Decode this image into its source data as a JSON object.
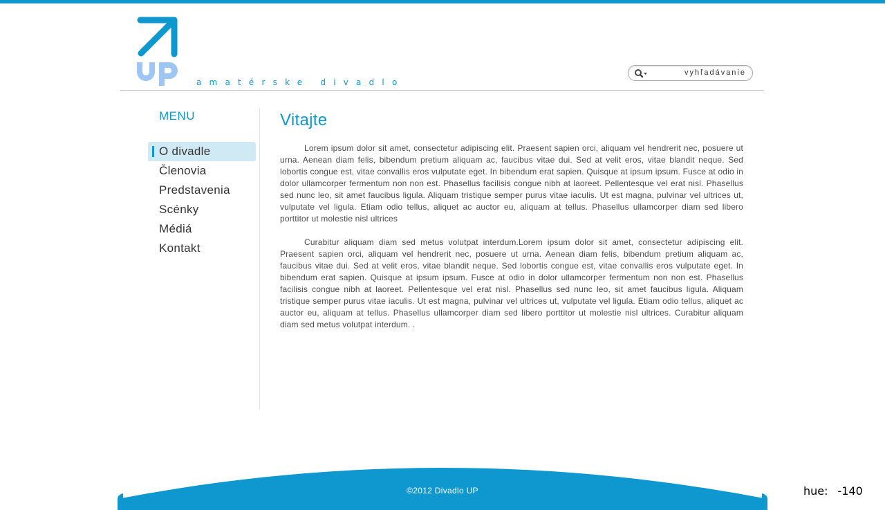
{
  "header": {
    "logo_letters": "UP",
    "tagline": "amatérske divadlo",
    "search": {
      "placeholder": "vyhľadávanie"
    }
  },
  "sidebar": {
    "title": "MENU",
    "items": [
      {
        "label": "O divadle",
        "active": true
      },
      {
        "label": "Členovia",
        "active": false
      },
      {
        "label": "Predstavenia",
        "active": false
      },
      {
        "label": "Scénky",
        "active": false
      },
      {
        "label": "Médiá",
        "active": false
      },
      {
        "label": "Kontakt",
        "active": false
      }
    ]
  },
  "content": {
    "title": "Vitajte",
    "paragraphs": [
      "Lorem ipsum dolor sit amet, consectetur adipiscing elit. Praesent sapien orci, aliquam vel hendrerit nec, posuere ut urna. Aenean diam felis, bibendum pretium aliquam ac, faucibus vitae dui. Sed at velit eros, vitae blandit neque. Sed lobortis congue est, vitae convallis eros vulputate eget. In bibendum erat sapien. Quisque at ipsum ipsum. Fusce at odio in dolor ullamcorper fermentum non non est. Phasellus facilisis congue nibh at laoreet. Pellentesque vel erat nisl. Phasellus sed nunc leo, sit amet faucibus ligula. Aliquam tristique semper purus vitae iaculis. Ut est magna, pulvinar vel ultrices ut, vulputate vel ligula. Etiam odio tellus, aliquet ac auctor eu, aliquam at tellus. Phasellus ullamcorper diam sed libero porttitor ut molestie nisl ultrices",
      "Curabitur aliquam diam sed metus volutpat interdum.Lorem ipsum dolor sit amet, consectetur adipiscing elit. Praesent sapien orci, aliquam vel hendrerit nec, posuere ut urna. Aenean diam felis, bibendum pretium aliquam ac, faucibus vitae dui. Sed at velit eros, vitae blandit neque. Sed lobortis congue est, vitae convallis eros vulputate eget. In bibendum erat sapien. Quisque at ipsum ipsum. Fusce at odio in dolor ullamcorper fermentum non non est. Phasellus facilisis congue nibh at laoreet. Pellentesque vel erat nisl. Phasellus sed nunc leo, sit amet faucibus ligula. Aliquam tristique semper purus vitae iaculis. Ut est magna, pulvinar vel ultrices ut, vulputate vel ligula. Etiam odio tellus, aliquet ac auctor eu, aliquam at tellus. Phasellus ullamcorper diam sed libero porttitor ut molestie nisl ultrices. Curabitur aliquam diam sed metus volutpat interdum. ."
    ]
  },
  "footer": {
    "copyright": "©2012   Divadlo UP"
  },
  "overlay": {
    "hue_label": "hue:",
    "hue_value": "-140"
  },
  "colors": {
    "accent": "#0e98cf",
    "logo_letters": "#9ec6f2",
    "active_bg": "#cfeaf5"
  }
}
